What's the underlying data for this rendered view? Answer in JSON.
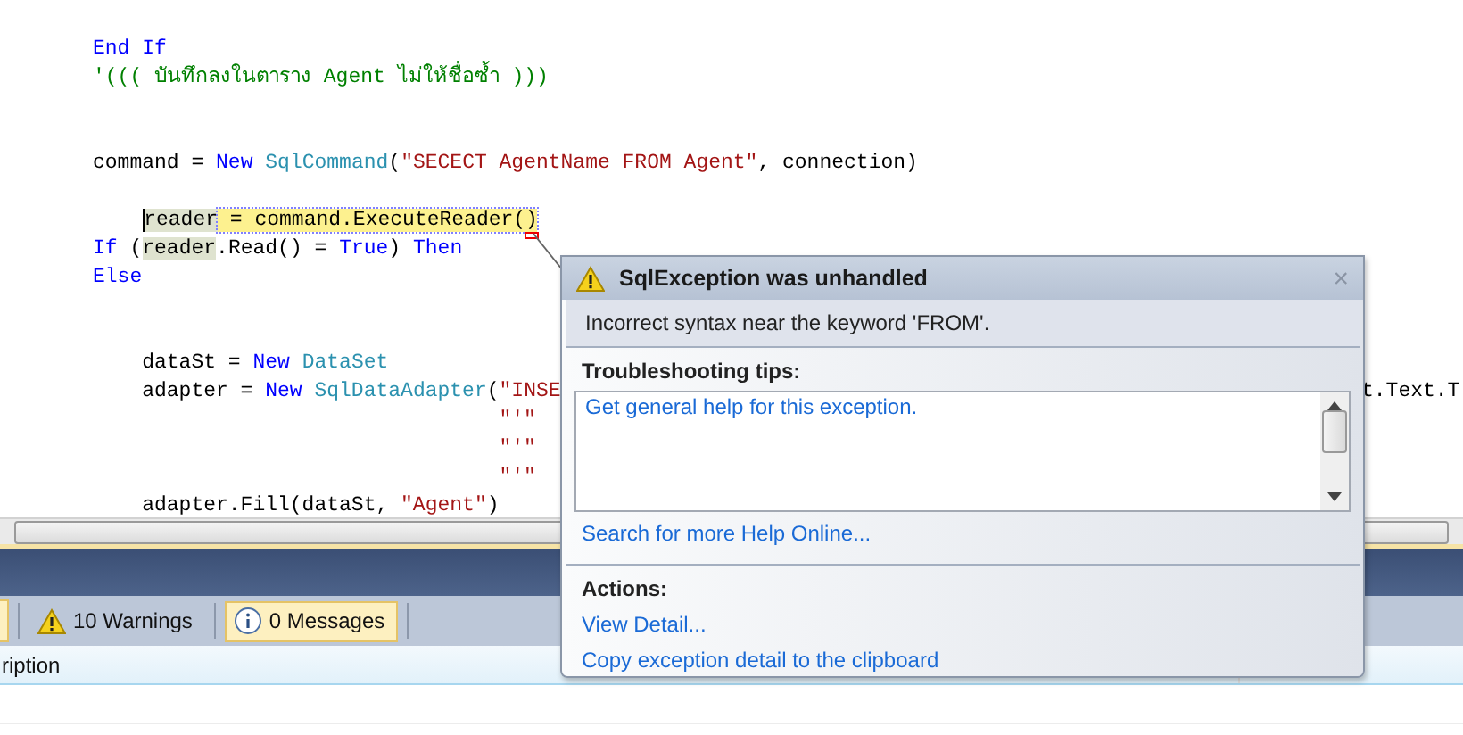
{
  "editor": {
    "lines": [
      {
        "kind": "top",
        "tokens": [
          {
            "kind": "kw",
            "text": "End If"
          }
        ]
      },
      {
        "kind": "top",
        "tokens": [
          {
            "kind": "comment",
            "text": "'((( บันทึกลงในตาราง Agent ไม่ให้ชื่อซ้ำ )))"
          }
        ]
      },
      {
        "kind": "blank"
      },
      {
        "kind": "blank"
      },
      {
        "kind": "top",
        "tokens": [
          {
            "kind": "plain",
            "text": "command = "
          },
          {
            "kind": "kw",
            "text": "New"
          },
          {
            "kind": "type",
            "text": " SqlCommand"
          },
          {
            "kind": "plain",
            "text": "("
          },
          {
            "kind": "str",
            "text": "\"SECECT AgentName FROM Agent\""
          },
          {
            "kind": "plain",
            "text": ", connection)"
          }
        ]
      },
      {
        "kind": "blank"
      },
      {
        "kind": "current",
        "tokens": [
          {
            "kind": "ref",
            "text": "reader"
          },
          {
            "kind": "stmt",
            "text": " = command.ExecuteReader()"
          }
        ]
      },
      {
        "kind": "top",
        "tokens": [
          {
            "kind": "kw",
            "text": "If"
          },
          {
            "kind": "plain",
            "text": " ("
          },
          {
            "kind": "ref",
            "text": "reader"
          },
          {
            "kind": "plain",
            "text": ".Read() = "
          },
          {
            "kind": "kw",
            "text": "True"
          },
          {
            "kind": "plain",
            "text": ") "
          },
          {
            "kind": "kw",
            "text": "Then"
          }
        ]
      },
      {
        "kind": "top",
        "tokens": [
          {
            "kind": "kw",
            "text": "Else"
          }
        ]
      },
      {
        "kind": "blank"
      },
      {
        "kind": "blank"
      },
      {
        "kind": "nested",
        "tokens": [
          {
            "kind": "plain",
            "text": "dataSt = "
          },
          {
            "kind": "kw",
            "text": "New"
          },
          {
            "kind": "type",
            "text": " DataSet"
          }
        ]
      },
      {
        "kind": "nested",
        "tokens": [
          {
            "kind": "plain",
            "text": "adapter = "
          },
          {
            "kind": "kw",
            "text": "New"
          },
          {
            "kind": "type",
            "text": " SqlDataAdapter"
          },
          {
            "kind": "plain",
            "text": "("
          },
          {
            "kind": "str",
            "text": "\"INSE"
          }
        ],
        "tail": "t.Text.T"
      },
      {
        "kind": "continuation",
        "tokens": [
          {
            "kind": "str",
            "text": "\"'\""
          }
        ]
      },
      {
        "kind": "continuation",
        "tokens": [
          {
            "kind": "str",
            "text": "\"'\""
          }
        ]
      },
      {
        "kind": "continuation",
        "tokens": [
          {
            "kind": "str",
            "text": "\"'\""
          }
        ]
      },
      {
        "kind": "nested",
        "tokens": [
          {
            "kind": "plain",
            "text": "adapter.Fill(dataSt, "
          },
          {
            "kind": "str",
            "text": "\"Agent\""
          },
          {
            "kind": "plain",
            "text": ")"
          }
        ]
      }
    ]
  },
  "error_list": {
    "buttons": [
      {
        "label": "10 Warnings",
        "kind": "warning",
        "selected": false
      },
      {
        "label": "0 Messages",
        "kind": "info",
        "selected": true
      }
    ],
    "columns": [
      "ription"
    ]
  },
  "exception_popup": {
    "title": "SqlException was unhandled",
    "close": "×",
    "message": "Incorrect syntax near the keyword 'FROM'.",
    "tips_heading": "Troubleshooting tips:",
    "tips": [
      "Get general help for this exception."
    ],
    "search_link": "Search for more Help Online...",
    "actions_heading": "Actions:",
    "actions": [
      "View Detail...",
      "Copy exception detail to the clipboard"
    ]
  }
}
